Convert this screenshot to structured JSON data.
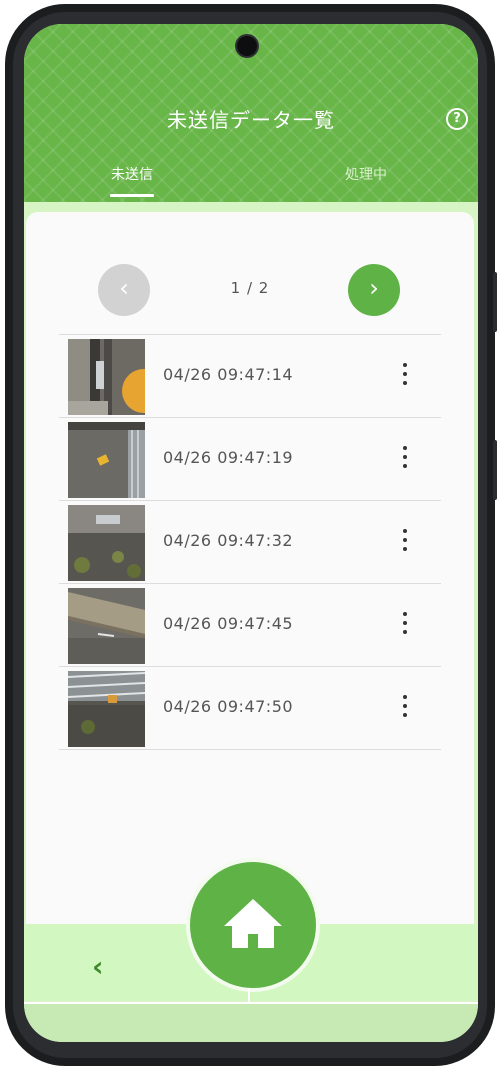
{
  "header": {
    "title": "未送信データ一覧",
    "help_icon": "question-circle-icon",
    "help_glyph": "?",
    "tabs": [
      {
        "label": "未送信",
        "active": true
      },
      {
        "label": "処理中",
        "active": false
      }
    ]
  },
  "pager": {
    "prev_glyph": "‹",
    "next_glyph": "›",
    "page_label": "1 / 2"
  },
  "items": [
    {
      "timestamp": "04/26 09:47:14",
      "menu_icon": "more-vert-icon"
    },
    {
      "timestamp": "04/26 09:47:19",
      "menu_icon": "more-vert-icon"
    },
    {
      "timestamp": "04/26 09:47:32",
      "menu_icon": "more-vert-icon"
    },
    {
      "timestamp": "04/26 09:47:45",
      "menu_icon": "more-vert-icon"
    },
    {
      "timestamp": "04/26 09:47:50",
      "menu_icon": "more-vert-icon"
    }
  ],
  "bottom": {
    "back_glyph": "‹",
    "home_icon": "home-icon"
  },
  "colors": {
    "primary": "#5fb246",
    "header": "#68b548",
    "disabled": "#d2d2d2",
    "bottom_bar": "#d3f7c1"
  }
}
